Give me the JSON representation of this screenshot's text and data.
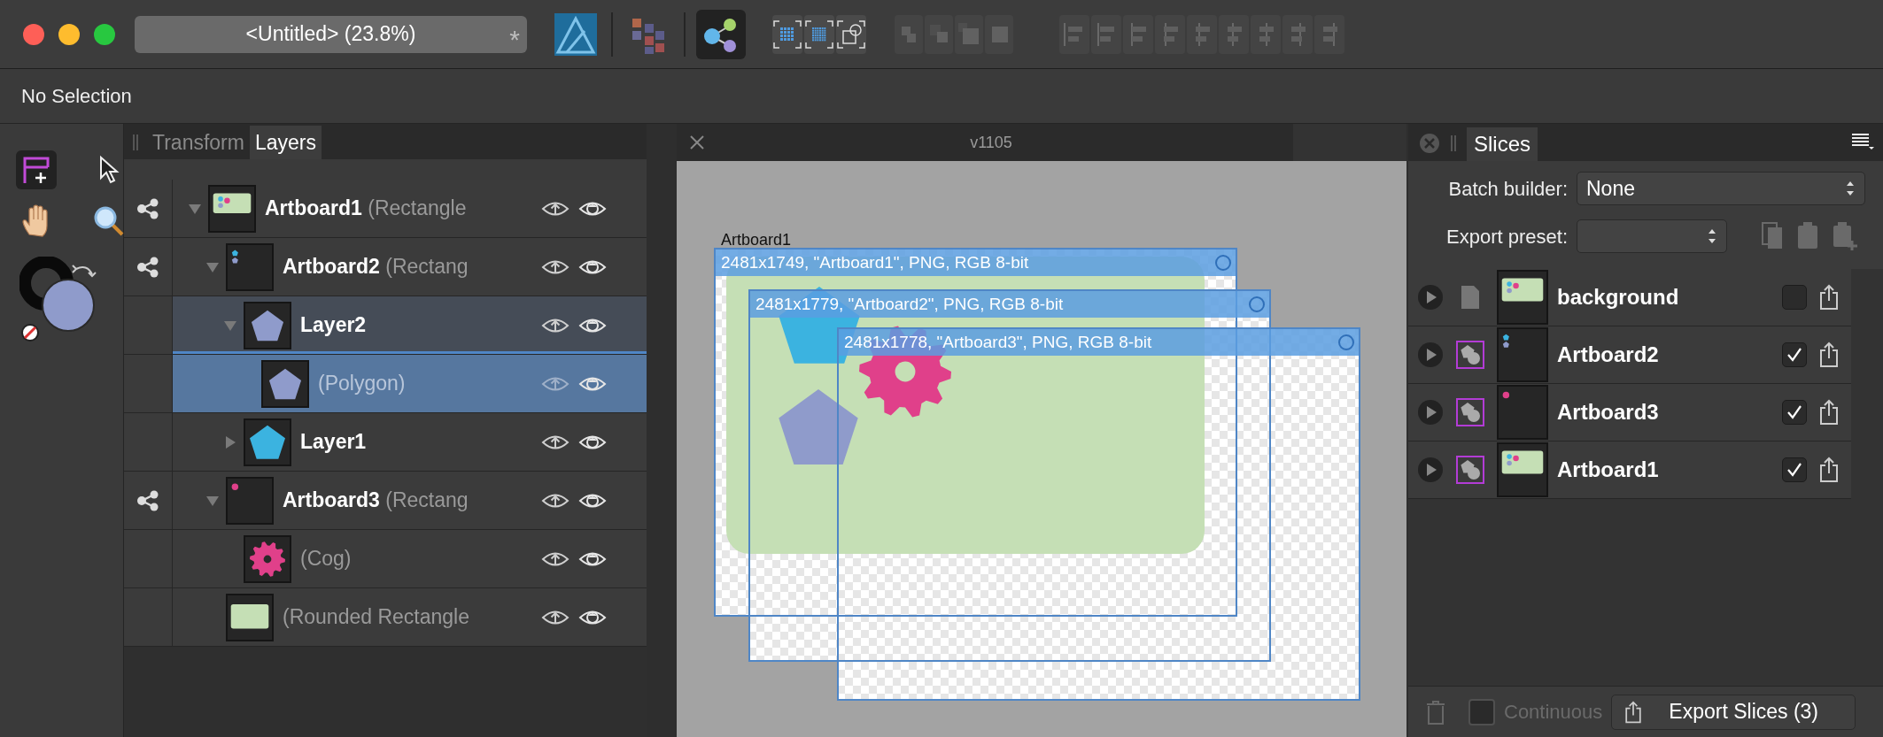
{
  "window": {
    "title": "<Untitled> (23.8%)",
    "modified_mark": "*"
  },
  "personas": [
    {
      "kind": "designer",
      "selected": false
    },
    {
      "kind": "pixel",
      "selected": false
    },
    {
      "kind": "export",
      "selected": true
    }
  ],
  "context_bar": {
    "status": "No Selection"
  },
  "tools": [
    {
      "kind": "slice",
      "selected": true
    },
    {
      "kind": "pointer",
      "selected": false
    },
    {
      "kind": "hand",
      "selected": false
    },
    {
      "kind": "zoom",
      "selected": false
    }
  ],
  "layers_panel": {
    "tabs": [
      {
        "label": "Transform",
        "selected": false
      },
      {
        "label": "Layers",
        "selected": true
      }
    ],
    "layers": [
      {
        "name": "Artboard1",
        "detail": "(Rectangle",
        "thumbnail": {
          "kind": "artboard-green"
        },
        "slice": true,
        "expanded": true,
        "selected": false,
        "highlighted": false,
        "children": [
          {
            "name": "Artboard2",
            "detail": "(Rectang",
            "thumbnail": {
              "kind": "artboard-shapes"
            },
            "slice": true,
            "expanded": true,
            "selected": false,
            "highlighted": false,
            "children": [
              {
                "name": "Layer2",
                "thumbnail": {
                  "kind": "pentagon-purple"
                },
                "slice": false,
                "expanded": true,
                "selected": false,
                "highlighted": true,
                "children": [
                  {
                    "detail": "(Polygon)",
                    "thumbnail": {
                      "kind": "pentagon-purple"
                    },
                    "slice": false,
                    "selected": true,
                    "highlighted": false
                  }
                ]
              },
              {
                "name": "Layer1",
                "thumbnail": {
                  "kind": "pentagon-blue"
                },
                "slice": false,
                "expanded": false,
                "selected": false,
                "highlighted": false
              }
            ]
          },
          {
            "name": "Artboard3",
            "detail": "(Rectang",
            "thumbnail": {
              "kind": "artboard-dot"
            },
            "slice": true,
            "expanded": true,
            "selected": false,
            "highlighted": false,
            "children": [
              {
                "detail": "(Cog)",
                "thumbnail": {
                  "kind": "cog"
                },
                "slice": false,
                "selected": false,
                "highlighted": false
              }
            ]
          },
          {
            "detail": "(Rounded Rectangle",
            "thumbnail": {
              "kind": "rounded-rect"
            },
            "slice": false,
            "selected": false,
            "highlighted": false
          }
        ]
      }
    ]
  },
  "canvas": {
    "document_tab": "v1105",
    "artboard_label": "Artboard1",
    "slices": [
      {
        "label": "2481x1749, \"Artboard1\", PNG, RGB 8-bit"
      },
      {
        "label": "2481x1779, \"Artboard2\", PNG, RGB 8-bit"
      },
      {
        "label": "2481x1778, \"Artboard3\", PNG, RGB 8-bit"
      }
    ]
  },
  "slices_panel": {
    "tab": "Slices",
    "batch_builder": {
      "label": "Batch builder:",
      "value": "None"
    },
    "export_preset": {
      "label": "Export preset:"
    },
    "slices": [
      {
        "name": "background",
        "kind": "document",
        "thumbnail": {
          "kind": "artboard-green"
        },
        "checked": false
      },
      {
        "name": "Artboard2",
        "kind": "artboard",
        "thumbnail": {
          "kind": "artboard-shapes"
        },
        "checked": true
      },
      {
        "name": "Artboard3",
        "kind": "artboard",
        "thumbnail": {
          "kind": "artboard-dot"
        },
        "checked": true
      },
      {
        "name": "Artboard1",
        "kind": "artboard",
        "thumbnail": {
          "kind": "artboard-green"
        },
        "checked": true
      }
    ],
    "continuous": {
      "label": "Continuous",
      "checked": false,
      "disabled": true
    },
    "export_button": "Export Slices (3)"
  }
}
